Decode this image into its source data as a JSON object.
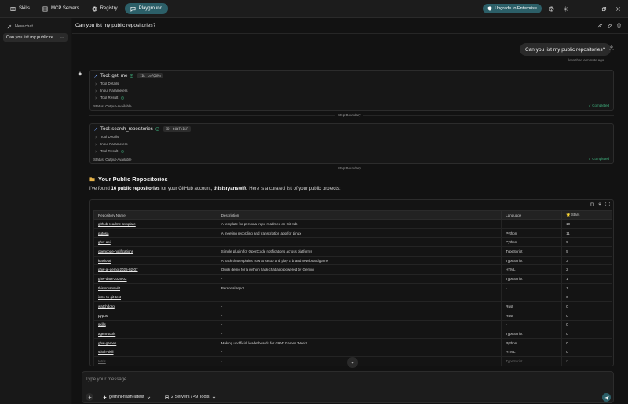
{
  "nav": {
    "tabs": [
      {
        "label": "Skills",
        "icon": "book-icon"
      },
      {
        "label": "MCP Servers",
        "icon": "server-icon"
      },
      {
        "label": "Registry",
        "icon": "globe-icon"
      },
      {
        "label": "Playground",
        "icon": "chat-icon",
        "active": true
      }
    ],
    "upgrade_label": "Upgrade to Enterprise"
  },
  "sidebar": {
    "new_chat_label": "New chat",
    "chats": [
      {
        "label": "Can you list my public repositories?"
      }
    ]
  },
  "chat": {
    "title": "Can you list my public repositories?",
    "user_message": "Can you list my public repositories?",
    "timestamp": "less than a minute ago"
  },
  "tool_calls": [
    {
      "tool_label": "Tool: get_me",
      "id_label": "ID: ce7QOMn",
      "details_label": "Tool Details",
      "params_label": "Input Parameters",
      "result_label": "Tool Result",
      "status": "Status: Output-Available",
      "completed": "✓ Completed"
    },
    {
      "tool_label": "Tool: search_repositories",
      "id_label": "ID: tUtTeIiP",
      "details_label": "Tool Details",
      "params_label": "Input Parameters",
      "result_label": "Tool Result",
      "status": "Status: Output-Available",
      "completed": "✓ Completed"
    }
  ],
  "step_boundary_label": "Step Boundary",
  "response": {
    "heading": "Your Public Repositories",
    "intro_prefix": "I've found ",
    "intro_count": "16 public repositories",
    "intro_mid": " for your GitHub account, ",
    "intro_user": "thisisryanswift",
    "intro_suffix": ". Here is a curated list of your public projects:"
  },
  "table": {
    "headers": [
      "Repository Name",
      "Description",
      "Language",
      "⭐ Stars"
    ],
    "rows": [
      [
        "github-readme-template",
        "A template for personal repo readmes on GitHub",
        "-",
        "10"
      ],
      [
        "gutosa",
        "A meeting recording and transcription app for Linux",
        "Python",
        "11"
      ],
      [
        "ghw-api",
        "-",
        "Python",
        "9"
      ],
      [
        "opencode-notifications",
        "Simple plugin for OpenCode notifications across platforms",
        "TypeScript",
        "5"
      ],
      [
        "klasio-ai",
        "A hack that explains how to setup and play a brand new board game",
        "TypeScript",
        "3"
      ],
      [
        "ghw-ai-demo-2025-02-07",
        "Quick demo for a python flask chat app powered by Gemini",
        "HTML",
        "2"
      ],
      [
        "ghw-data-2026-02",
        "-",
        "TypeScript",
        "1"
      ],
      [
        "thisisryanswift",
        "Personal repo!",
        "-",
        "1"
      ],
      [
        "intro-to-git-test",
        "-",
        "-",
        "0"
      ],
      [
        "watchdorg",
        "-",
        "Rust",
        "0"
      ],
      [
        "pypus",
        "-",
        "Rust",
        "0"
      ],
      [
        "skills",
        "-",
        "-",
        "0"
      ],
      [
        "agent-tools",
        "-",
        "TypeScript",
        "0"
      ],
      [
        "ghw-games",
        "Making unofficial leaderboards for GHW Games Week!",
        "Python",
        "0"
      ],
      [
        "stitch-skill",
        "-",
        "HTML",
        "0"
      ],
      [
        "tetris",
        "-",
        "TypeScript",
        "0"
      ]
    ]
  },
  "composer": {
    "placeholder": "Type your message...",
    "model_label": "gemini-flash-latest",
    "servers_label": "2 Servers / 49 Tools"
  }
}
